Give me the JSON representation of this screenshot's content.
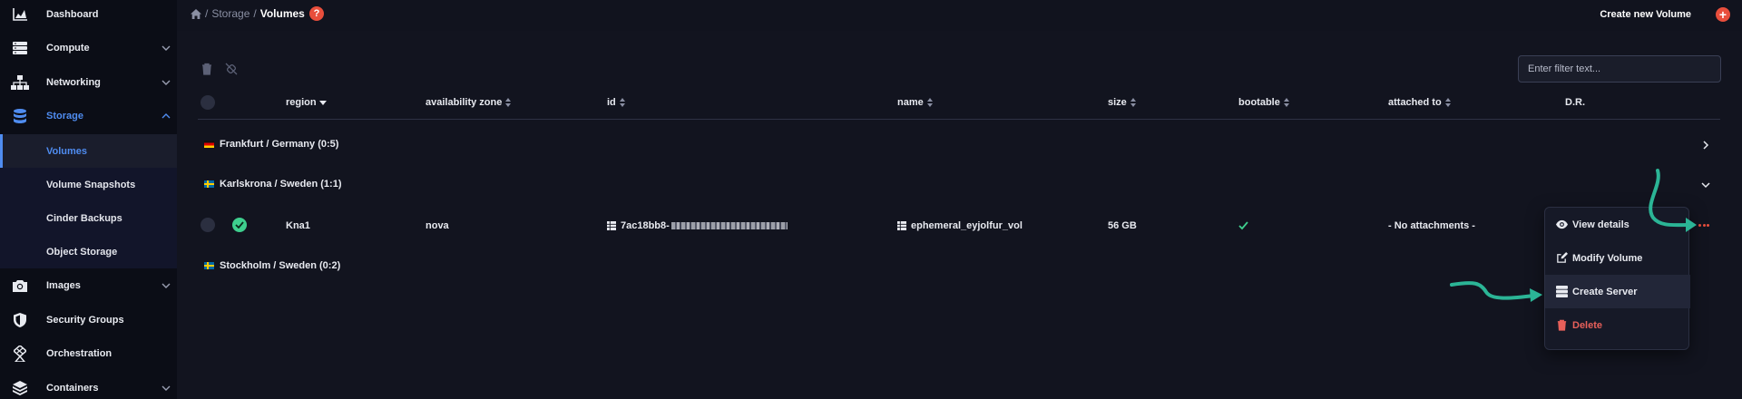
{
  "sidebar": {
    "items": [
      {
        "label": "Dashboard"
      },
      {
        "label": "Compute"
      },
      {
        "label": "Networking"
      },
      {
        "label": "Storage"
      },
      {
        "label": "Images"
      },
      {
        "label": "Security Groups"
      },
      {
        "label": "Orchestration"
      },
      {
        "label": "Containers"
      }
    ],
    "storage_sub": [
      {
        "label": "Volumes"
      },
      {
        "label": "Volume Snapshots"
      },
      {
        "label": "Cinder Backups"
      },
      {
        "label": "Object Storage"
      }
    ]
  },
  "header": {
    "breadcrumb": [
      "Storage",
      "Volumes"
    ],
    "sep": "/",
    "help": "?",
    "create_label": "Create new Volume",
    "create_plus": "+"
  },
  "filter": {
    "placeholder": "Enter filter text..."
  },
  "table": {
    "columns": [
      "region",
      "availability zone",
      "id",
      "name",
      "size",
      "bootable",
      "attached to",
      "D.R."
    ],
    "groups": [
      {
        "label": "Frankfurt / Germany (0:5)"
      },
      {
        "label": "Karlskrona / Sweden (1:1)"
      },
      {
        "label": "Stockholm / Sweden (0:2)"
      }
    ],
    "row": {
      "region": "Kna1",
      "availability_zone": "nova",
      "id_prefix": "7ac18bb8-",
      "name": "ephemeral_eyjolfur_vol",
      "size": "56 GB",
      "attached_to": "- No attachments -"
    }
  },
  "menu": {
    "items": [
      {
        "label": "View details"
      },
      {
        "label": "Modify Volume"
      },
      {
        "label": "Create Server"
      },
      {
        "label": "Delete"
      }
    ]
  },
  "colors": {
    "accent": "#4f8cf0",
    "danger": "#e84e3c",
    "success": "#3ecf8e",
    "annotation": "#2bb596"
  }
}
